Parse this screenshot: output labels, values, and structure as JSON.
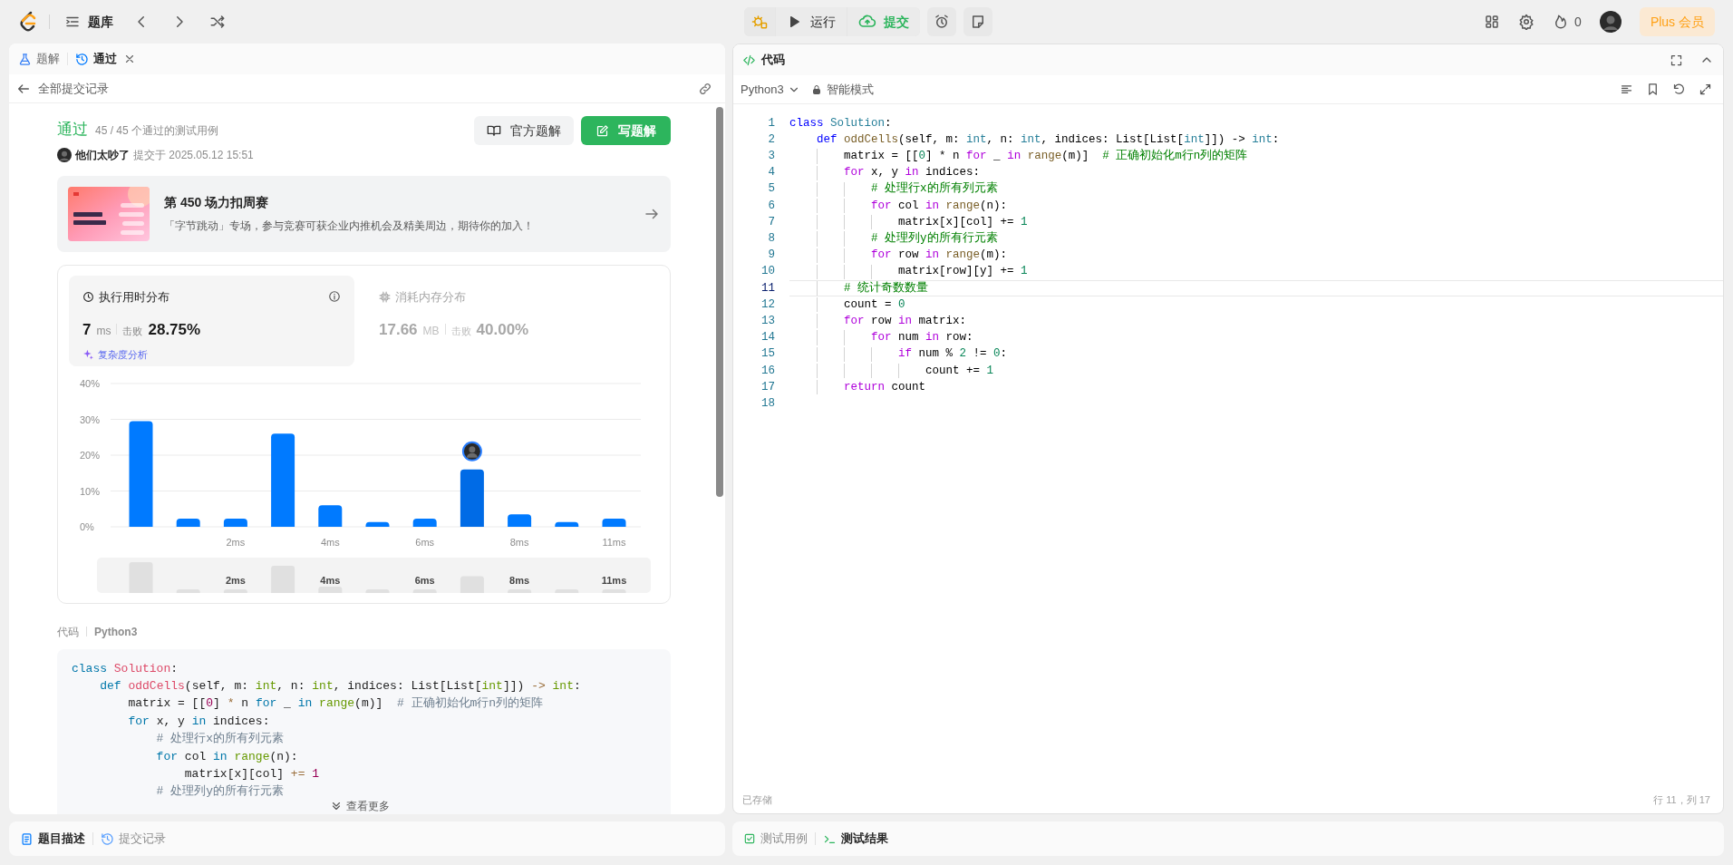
{
  "topbar": {
    "nav_label": "题库",
    "run_label": "运行",
    "submit_label": "提交",
    "streak": "0",
    "plus_label": "Plus 会员"
  },
  "left_tabs": [
    {
      "label": "题解",
      "selected": false,
      "closable": false
    },
    {
      "label": "通过",
      "selected": true,
      "closable": true
    }
  ],
  "back_link": "全部提交记录",
  "result": {
    "status": "通过",
    "cases": "45 / 45 个通过的测试用例",
    "user": "他们太吵了",
    "submitted": "提交于 2025.05.12 15:51",
    "official_button": "官方题解",
    "write_button": "写题解"
  },
  "banner": {
    "title": "第 450 场力扣周赛",
    "subtitle": "「字节跳动」专场，参与竞赛可获企业内推机会及精美周边，期待你的加入！"
  },
  "stats": [
    {
      "title": "执行用时分布",
      "value": "7",
      "unit": "ms",
      "beat_label": "击败",
      "beat": "28.75%",
      "selected": true,
      "link": "复杂度分析"
    },
    {
      "title": "消耗内存分布",
      "value": "17.66",
      "unit": "MB",
      "beat_label": "击败",
      "beat": "40.00%",
      "selected": false
    }
  ],
  "chart_data": {
    "type": "bar",
    "categories": [
      null,
      null,
      "2ms",
      null,
      "4ms",
      null,
      "6ms",
      null,
      "8ms",
      null,
      "11ms"
    ],
    "series": [
      {
        "color": "#007aff",
        "values": [
          29.5,
          2.3,
          2.3,
          26,
          6,
          1.3,
          2.3,
          null,
          3.5,
          1.3,
          2.3
        ]
      },
      {
        "color": "#006be6",
        "values": [
          null,
          null,
          null,
          null,
          null,
          null,
          null,
          16,
          null,
          null,
          null
        ]
      }
    ],
    "ylim": [
      0,
      40
    ],
    "yticks": [
      {
        "value": 0,
        "label": "0%"
      },
      {
        "value": 10,
        "label": "10%"
      },
      {
        "value": 20,
        "label": "20%"
      },
      {
        "value": 30,
        "label": "30%"
      },
      {
        "value": 40,
        "label": "40%"
      }
    ],
    "grid": true
  },
  "navigator": {
    "labels": [
      "2ms",
      "4ms",
      "6ms",
      "8ms",
      "11ms"
    ]
  },
  "code_section": {
    "label": "代码",
    "language": "Python3",
    "more": "查看更多",
    "lines": [
      [
        {
          "text": "class ",
          "kind": "kw"
        },
        {
          "text": "Solution",
          "kind": "cls"
        },
        {
          "text": ":",
          "kind": "p"
        }
      ],
      [
        {
          "text": "    def ",
          "kind": "kw"
        },
        {
          "text": "oddCells",
          "kind": "fn"
        },
        {
          "text": "(self, m: ",
          "kind": "p"
        },
        {
          "text": "int",
          "kind": "ty"
        },
        {
          "text": ", n: ",
          "kind": "p"
        },
        {
          "text": "int",
          "kind": "ty"
        },
        {
          "text": ", indices: List[List[",
          "kind": "p"
        },
        {
          "text": "int",
          "kind": "ty"
        },
        {
          "text": "]]) ",
          "kind": "p"
        },
        {
          "text": "-> ",
          "kind": "op"
        },
        {
          "text": "int",
          "kind": "ty"
        },
        {
          "text": ":",
          "kind": "p"
        }
      ],
      [
        {
          "text": "        matrix = [[",
          "kind": "p"
        },
        {
          "text": "0",
          "kind": "num"
        },
        {
          "text": "] ",
          "kind": "p"
        },
        {
          "text": "*",
          "kind": "op"
        },
        {
          "text": " n ",
          "kind": "p"
        },
        {
          "text": "for",
          "kind": "ctl"
        },
        {
          "text": " _ ",
          "kind": "p"
        },
        {
          "text": "in ",
          "kind": "ctl"
        },
        {
          "text": "range",
          "kind": "bi"
        },
        {
          "text": "(m)]  ",
          "kind": "p"
        },
        {
          "text": "# 正确初始化m行n列的矩阵",
          "kind": "cm"
        }
      ],
      [
        {
          "text": "        for",
          "kind": "ctl"
        },
        {
          "text": " x, y ",
          "kind": "p"
        },
        {
          "text": "in",
          "kind": "ctl"
        },
        {
          "text": " indices:",
          "kind": "p"
        }
      ],
      [
        {
          "text": "            # 处理行x的所有列元素",
          "kind": "cm"
        }
      ],
      [
        {
          "text": "            for",
          "kind": "ctl"
        },
        {
          "text": " col ",
          "kind": "p"
        },
        {
          "text": "in ",
          "kind": "ctl"
        },
        {
          "text": "range",
          "kind": "bi"
        },
        {
          "text": "(n):",
          "kind": "p"
        }
      ],
      [
        {
          "text": "                matrix[x][col] ",
          "kind": "p"
        },
        {
          "text": "+=",
          "kind": "op"
        },
        {
          "text": " 1",
          "kind": "num"
        }
      ],
      [
        {
          "text": "            # 处理列y的所有行元素",
          "kind": "cm"
        }
      ]
    ]
  },
  "bottom_left_tabs": [
    {
      "label": "题目描述",
      "selected": true
    },
    {
      "label": "提交记录",
      "selected": false
    }
  ],
  "editor": {
    "title": "代码",
    "language": "Python3",
    "mode": "智能模式",
    "status": "已存储",
    "cursor": "行 11，列 17",
    "lines": [
      {
        "n": "1",
        "selected": false,
        "tokens": [
          {
            "text": "class ",
            "kind": "kw"
          },
          {
            "text": "Solution",
            "kind": "cls"
          },
          {
            "text": ":",
            "kind": "p"
          }
        ]
      },
      {
        "n": "2",
        "selected": false,
        "tokens": [
          {
            "text": "    def ",
            "kind": "kw"
          },
          {
            "text": "oddCells",
            "kind": "fn"
          },
          {
            "text": "(self, m: ",
            "kind": "p"
          },
          {
            "text": "int",
            "kind": "ty"
          },
          {
            "text": ", n: ",
            "kind": "p"
          },
          {
            "text": "int",
            "kind": "ty"
          },
          {
            "text": ", indices: List[List[",
            "kind": "p"
          },
          {
            "text": "int",
            "kind": "ty"
          },
          {
            "text": "]]) ",
            "kind": "p"
          },
          {
            "text": "-> ",
            "kind": "op"
          },
          {
            "text": "int",
            "kind": "ty"
          },
          {
            "text": ":",
            "kind": "p"
          }
        ]
      },
      {
        "n": "3",
        "selected": false,
        "tokens": [
          {
            "text": "        matrix = [[",
            "kind": "p"
          },
          {
            "text": "0",
            "kind": "num"
          },
          {
            "text": "] ",
            "kind": "p"
          },
          {
            "text": "*",
            "kind": "op"
          },
          {
            "text": " n ",
            "kind": "p"
          },
          {
            "text": "for",
            "kind": "ctl"
          },
          {
            "text": " _ ",
            "kind": "p"
          },
          {
            "text": "in ",
            "kind": "ctl"
          },
          {
            "text": "range",
            "kind": "bi"
          },
          {
            "text": "(m)]  ",
            "kind": "p"
          },
          {
            "text": "# 正确初始化m行n列的矩阵",
            "kind": "cm"
          }
        ]
      },
      {
        "n": "4",
        "selected": false,
        "tokens": [
          {
            "text": "        for",
            "kind": "ctl"
          },
          {
            "text": " x, y ",
            "kind": "p"
          },
          {
            "text": "in",
            "kind": "ctl"
          },
          {
            "text": " indices:",
            "kind": "p"
          }
        ]
      },
      {
        "n": "5",
        "selected": false,
        "tokens": [
          {
            "text": "            # 处理行x的所有列元素",
            "kind": "cm"
          }
        ]
      },
      {
        "n": "6",
        "selected": false,
        "tokens": [
          {
            "text": "            for",
            "kind": "ctl"
          },
          {
            "text": " col ",
            "kind": "p"
          },
          {
            "text": "in ",
            "kind": "ctl"
          },
          {
            "text": "range",
            "kind": "bi"
          },
          {
            "text": "(n):",
            "kind": "p"
          }
        ]
      },
      {
        "n": "7",
        "selected": false,
        "tokens": [
          {
            "text": "                matrix[x][col] ",
            "kind": "p"
          },
          {
            "text": "+=",
            "kind": "op"
          },
          {
            "text": " 1",
            "kind": "num"
          }
        ]
      },
      {
        "n": "8",
        "selected": false,
        "tokens": [
          {
            "text": "            # 处理列y的所有行元素",
            "kind": "cm"
          }
        ]
      },
      {
        "n": "9",
        "selected": false,
        "tokens": [
          {
            "text": "            for",
            "kind": "ctl"
          },
          {
            "text": " row ",
            "kind": "p"
          },
          {
            "text": "in ",
            "kind": "ctl"
          },
          {
            "text": "range",
            "kind": "bi"
          },
          {
            "text": "(m):",
            "kind": "p"
          }
        ]
      },
      {
        "n": "10",
        "selected": false,
        "tokens": [
          {
            "text": "                matrix[row][y] ",
            "kind": "p"
          },
          {
            "text": "+=",
            "kind": "op"
          },
          {
            "text": " 1",
            "kind": "num"
          }
        ]
      },
      {
        "n": "11",
        "selected": true,
        "tokens": [
          {
            "text": "        # 统计奇数数量",
            "kind": "cm"
          }
        ]
      },
      {
        "n": "12",
        "selected": false,
        "tokens": [
          {
            "text": "        count = ",
            "kind": "p"
          },
          {
            "text": "0",
            "kind": "num"
          }
        ]
      },
      {
        "n": "13",
        "selected": false,
        "tokens": [
          {
            "text": "        for",
            "kind": "ctl"
          },
          {
            "text": " row ",
            "kind": "p"
          },
          {
            "text": "in",
            "kind": "ctl"
          },
          {
            "text": " matrix:",
            "kind": "p"
          }
        ]
      },
      {
        "n": "14",
        "selected": false,
        "tokens": [
          {
            "text": "            for",
            "kind": "ctl"
          },
          {
            "text": " num ",
            "kind": "p"
          },
          {
            "text": "in",
            "kind": "ctl"
          },
          {
            "text": " row:",
            "kind": "p"
          }
        ]
      },
      {
        "n": "15",
        "selected": false,
        "tokens": [
          {
            "text": "                if",
            "kind": "ctl"
          },
          {
            "text": " num % ",
            "kind": "p"
          },
          {
            "text": "2",
            "kind": "num"
          },
          {
            "text": " != ",
            "kind": "p"
          },
          {
            "text": "0",
            "kind": "num"
          },
          {
            "text": ":",
            "kind": "p"
          }
        ]
      },
      {
        "n": "16",
        "selected": false,
        "tokens": [
          {
            "text": "                    count += ",
            "kind": "p"
          },
          {
            "text": "1",
            "kind": "num"
          }
        ]
      },
      {
        "n": "17",
        "selected": false,
        "tokens": [
          {
            "text": "        return",
            "kind": "ctl"
          },
          {
            "text": " count",
            "kind": "p"
          }
        ]
      },
      {
        "n": "18",
        "selected": false
      }
    ]
  },
  "bottom_right_tabs": [
    {
      "label": "测试用例",
      "selected": false
    },
    {
      "label": "测试结果",
      "selected": true
    }
  ]
}
